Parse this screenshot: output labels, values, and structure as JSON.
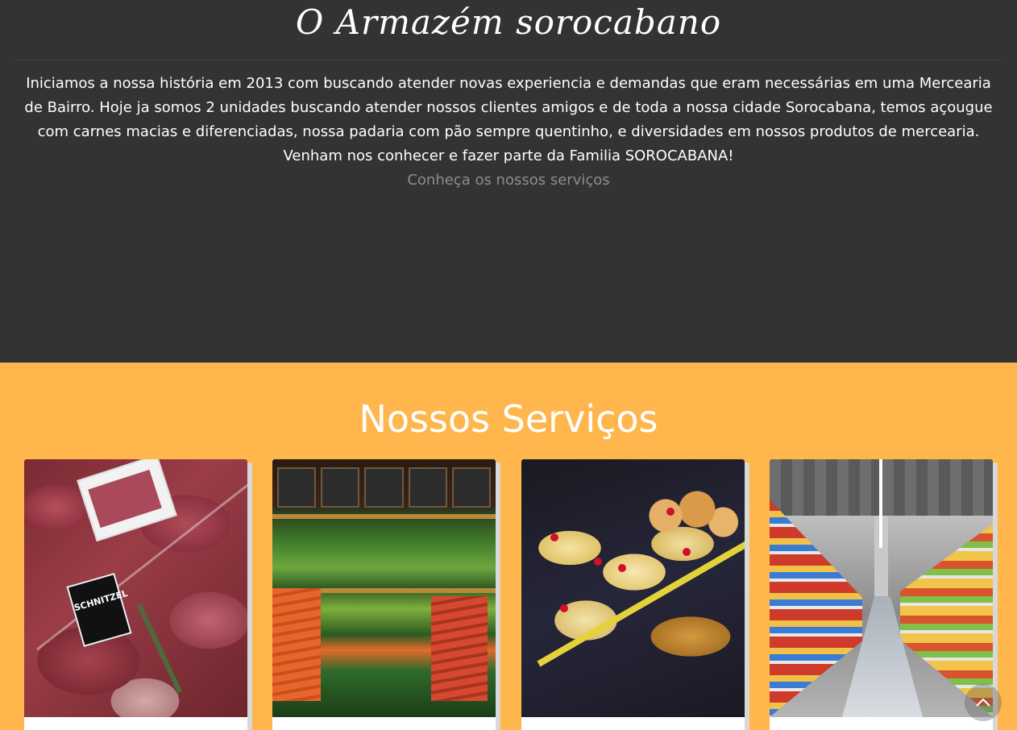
{
  "hero": {
    "title": "O Armazém sorocabano",
    "text": "Iniciamos a nossa história em 2013 com buscando atender novas experiencia e demandas que eram necessárias em uma Mercearia de Bairro. Hoje ja somos 2 unidades buscando atender nossos clientes amigos e de toda a nossa cidade Sorocabana, temos açougue com carnes macias e diferenciadas, nossa padaria com pão sempre quentinho, e diversidades em nossos produtos de mercearia. Venham nos conhecer e fazer parte da Familia SOROCABANA!",
    "link_label": "Conheça os nossos serviços"
  },
  "services": {
    "title": "Nossos Serviços",
    "cards": [
      {
        "image": "butcher-meat-display",
        "label_text": "SCHNITZEL"
      },
      {
        "image": "produce-vegetables-display"
      },
      {
        "image": "bakery-pastry-display"
      },
      {
        "image": "supermarket-aisle"
      }
    ]
  },
  "back_to_top": {
    "icon": "chevron-up-icon"
  },
  "colors": {
    "hero_bg": "#333333",
    "services_bg": "#ffb74d",
    "text_light": "#ffffff",
    "link_muted": "#8c8c8c"
  }
}
